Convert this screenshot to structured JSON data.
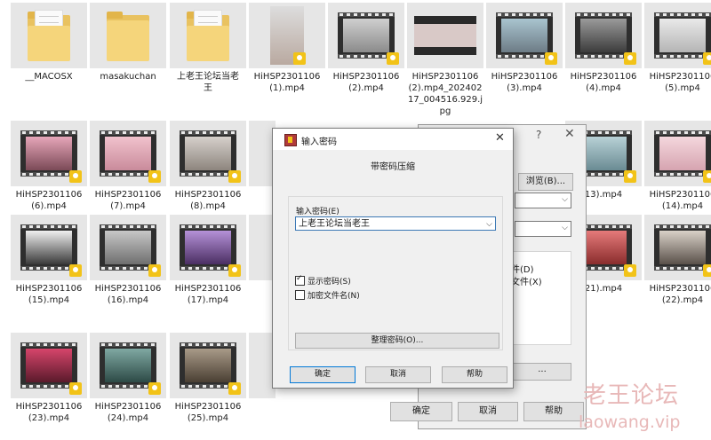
{
  "explorer": {
    "items": [
      {
        "kind": "folder",
        "label": "__MACOSX"
      },
      {
        "kind": "folder-plain",
        "label": "masakuchan"
      },
      {
        "kind": "folder",
        "label": "上老王论坛当老\n王"
      },
      {
        "kind": "portrait",
        "label": "HiHSP2301106\n(1).mp4"
      },
      {
        "kind": "video",
        "label": "HiHSP2301106\n(2).mp4"
      },
      {
        "kind": "image",
        "label": "HiHSP2301106\n(2).mp4_202402\n17_004516.929.j\npg"
      },
      {
        "kind": "video",
        "label": "HiHSP2301106\n(3).mp4"
      },
      {
        "kind": "video",
        "label": "HiHSP2301106\n(4).mp4"
      },
      {
        "kind": "video",
        "label": "HiHSP2301106\n(5).mp4"
      },
      {
        "kind": "video",
        "label": "HiHSP2301106\n(6).mp4"
      },
      {
        "kind": "video",
        "label": "HiHSP2301106\n(7).mp4"
      },
      {
        "kind": "video",
        "label": "HiHSP2301106\n(8).mp4"
      },
      {
        "kind": "video",
        "label": "13).mp4"
      },
      {
        "kind": "video",
        "label": "HiHSP2301106\n(14).mp4"
      },
      {
        "kind": "video",
        "label": "HiHSP2301106\n(15).mp4"
      },
      {
        "kind": "video",
        "label": "HiHSP2301106\n(16).mp4"
      },
      {
        "kind": "video",
        "label": "HiHSP2301106\n(17).mp4"
      },
      {
        "kind": "video",
        "label": "21).mp4"
      },
      {
        "kind": "video",
        "label": "HiHSP2301106\n(22).mp4"
      },
      {
        "kind": "video",
        "label": "HiHSP2301106\n(23).mp4"
      },
      {
        "kind": "video",
        "label": "HiHSP2301106\n(24).mp4"
      },
      {
        "kind": "video",
        "label": "HiHSP2301106\n(25).mp4"
      }
    ],
    "player_badge": "Player"
  },
  "archive_dialog": {
    "help_glyph": "?",
    "close_glyph": "✕",
    "browse_label": "浏览(B)...",
    "option1": "件(D)",
    "option2": "文件(X)",
    "dots_label": "...",
    "ok_label": "确定",
    "cancel_label": "取消",
    "help_label": "帮助"
  },
  "password_dialog": {
    "title": "输入密码",
    "close_glyph": "✕",
    "heading": "带密码压缩",
    "field_label": "输入密码(E)",
    "field_value": "上老王论坛当老王",
    "dropdown_glyph": "⌵",
    "show_password": {
      "label": "显示密码(S)",
      "checked": true
    },
    "encrypt_names": {
      "label": "加密文件名(N)",
      "checked": false
    },
    "manage_label": "整理密码(O)...",
    "ok_label": "确定",
    "cancel_label": "取消",
    "help_label": "帮助"
  },
  "watermark": {
    "text": "老王论坛",
    "url": "laowang.vip"
  },
  "colors": {
    "folder": "#f5d57b",
    "badge": "#f2c318",
    "focus_border": "#0078d7",
    "watermark": "#e8b8b8"
  }
}
